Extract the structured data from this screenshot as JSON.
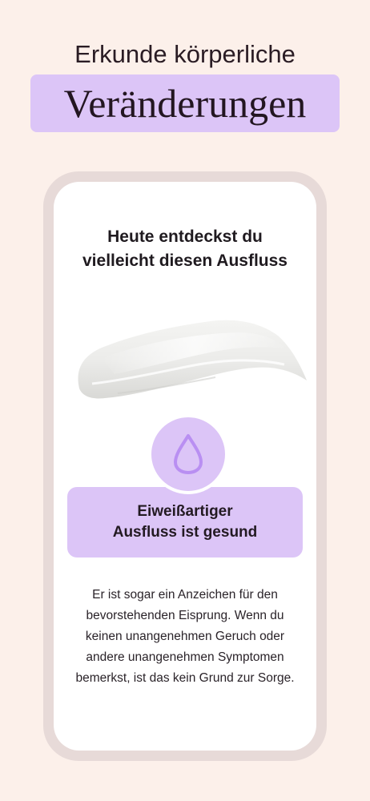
{
  "header": {
    "title_line1": "Erkunde körperliche",
    "title_line2": "Veränderungen"
  },
  "card": {
    "title_line1": "Heute entdeckst du",
    "title_line2": "vielleicht diesen Ausfluss",
    "image": "creamy-white-discharge-swatch",
    "icon": "drop-icon",
    "result_line1": "Eiweißartiger",
    "result_line2": "Ausfluss ist gesund",
    "description": "Er ist sogar ein Anzeichen für den bevorstehenden Eisprung. Wenn du keinen unangenehmen Geruch oder andere unangenehmen Symptomen bemerkst, ist das kein Grund zur Sorge."
  },
  "colors": {
    "background": "#fcf0ea",
    "accent_lavender": "#dcc5f7",
    "icon_purple": "#b98ff2",
    "frame": "#e7dad8"
  }
}
